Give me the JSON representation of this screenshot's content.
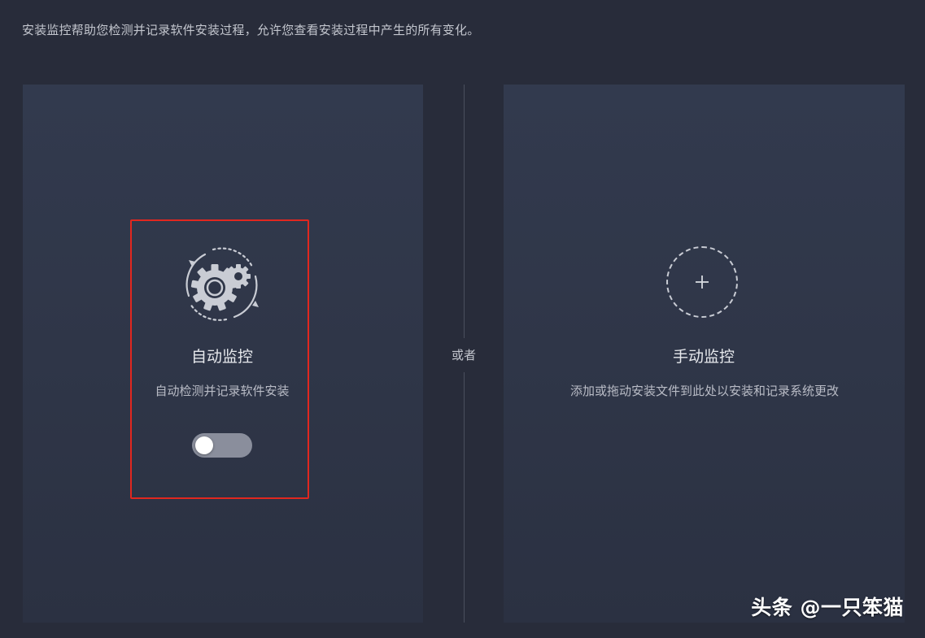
{
  "header": {
    "description": "安装监控帮助您检测并记录软件安装过程，允许您查看安装过程中产生的所有变化。"
  },
  "auto_monitor": {
    "icon": "gear-cycle-icon",
    "title": "自动监控",
    "subtitle": "自动检测并记录软件安装",
    "toggle_on": false
  },
  "divider": {
    "label": "或者"
  },
  "manual_monitor": {
    "icon": "plus-icon",
    "title": "手动监控",
    "subtitle": "添加或拖动安装文件到此处以安装和记录系统更改"
  },
  "watermark": {
    "text": "头条 @一只笨猫"
  },
  "colors": {
    "background": "#282c3a",
    "panel": "#323a4e",
    "highlight": "#e1271f",
    "toggle_off": "#8a8e9c"
  }
}
